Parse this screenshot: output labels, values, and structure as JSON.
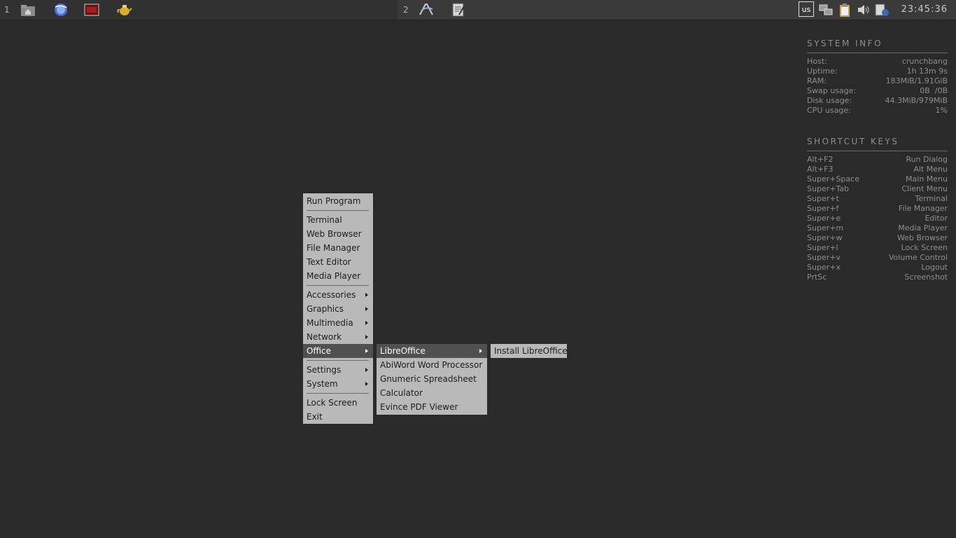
{
  "panel": {
    "workspace1": "1",
    "workspace2": "2",
    "keyboard_layout": "us",
    "clock": "23:45:36",
    "launchers": [
      "home-folder-icon",
      "web-browser-icon",
      "terminal-icon",
      "teapot-icon"
    ],
    "workspace2_apps": [
      "inkscape-icon",
      "text-editor-icon"
    ],
    "tray": [
      "network-icon",
      "clipboard-icon",
      "volume-icon",
      "update-notifier-icon"
    ]
  },
  "conky": {
    "system_title": "SYSTEM INFO",
    "system_rows": [
      {
        "label": "Host:",
        "value": "crunchbang"
      },
      {
        "label": "Uptime:",
        "value": "1h 13m 9s"
      },
      {
        "label": "RAM:",
        "value": "183MiB/1.91GiB"
      },
      {
        "label": "Swap usage:",
        "value": "0B  /0B"
      },
      {
        "label": "Disk usage:",
        "value": "44.3MiB/979MiB"
      },
      {
        "label": "CPU usage:",
        "value": "1%"
      }
    ],
    "shortcuts_title": "SHORTCUT KEYS",
    "shortcut_rows": [
      {
        "label": "Alt+F2",
        "value": "Run Dialog"
      },
      {
        "label": "Alt+F3",
        "value": "Alt Menu"
      },
      {
        "label": "Super+Space",
        "value": "Main Menu"
      },
      {
        "label": "Super+Tab",
        "value": "Client Menu"
      },
      {
        "label": "Super+t",
        "value": "Terminal"
      },
      {
        "label": "Super+f",
        "value": "File Manager"
      },
      {
        "label": "Super+e",
        "value": "Editor"
      },
      {
        "label": "Super+m",
        "value": "Media Player"
      },
      {
        "label": "Super+w",
        "value": "Web Browser"
      },
      {
        "label": "Super+l",
        "value": "Lock Screen"
      },
      {
        "label": "Super+v",
        "value": "Volume Control"
      },
      {
        "label": "Super+x",
        "value": "Logout"
      },
      {
        "label": "PrtSc",
        "value": "Screenshot"
      }
    ]
  },
  "main_menu": {
    "items": [
      "Run Program",
      "Terminal",
      "Web Browser",
      "File Manager",
      "Text Editor",
      "Media Player",
      "Accessories",
      "Graphics",
      "Multimedia",
      "Network",
      "Office",
      "Settings",
      "System",
      "Lock Screen",
      "Exit"
    ]
  },
  "office_menu": {
    "items": [
      "LibreOffice",
      "AbiWord Word Processor",
      "Gnumeric Spreadsheet",
      "Calculator",
      "Evince PDF Viewer"
    ]
  },
  "libreoffice_menu": {
    "items": [
      "Install LibreOffice"
    ]
  }
}
